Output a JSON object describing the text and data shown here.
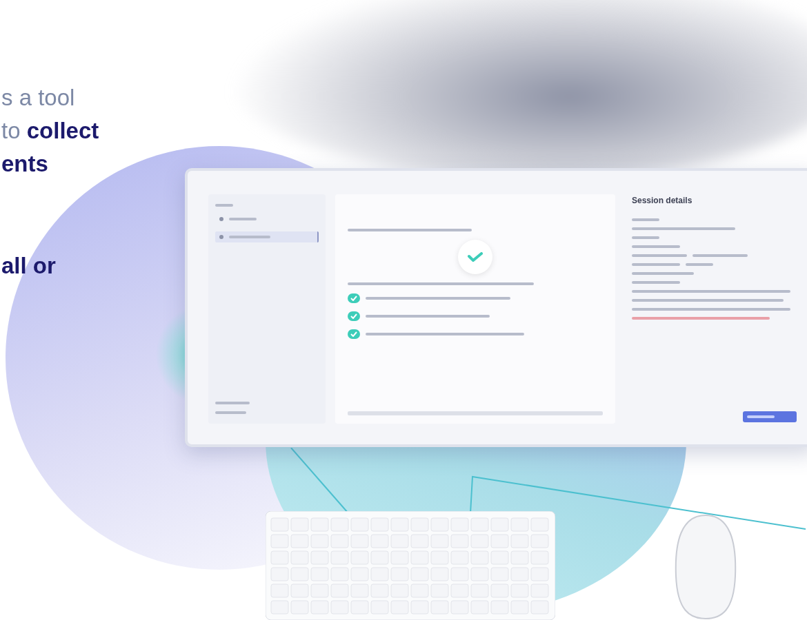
{
  "hero": {
    "paragraphs": [
      "s a tool\nto **collect**\nents",
      "all or"
    ]
  },
  "monitor": {
    "sidebar": {
      "items": [
        {
          "selected": false
        },
        {
          "selected": true
        }
      ]
    },
    "checklist": [
      {
        "checked": true
      },
      {
        "checked": true
      },
      {
        "checked": true
      }
    ],
    "details": {
      "title": "Session details"
    }
  }
}
